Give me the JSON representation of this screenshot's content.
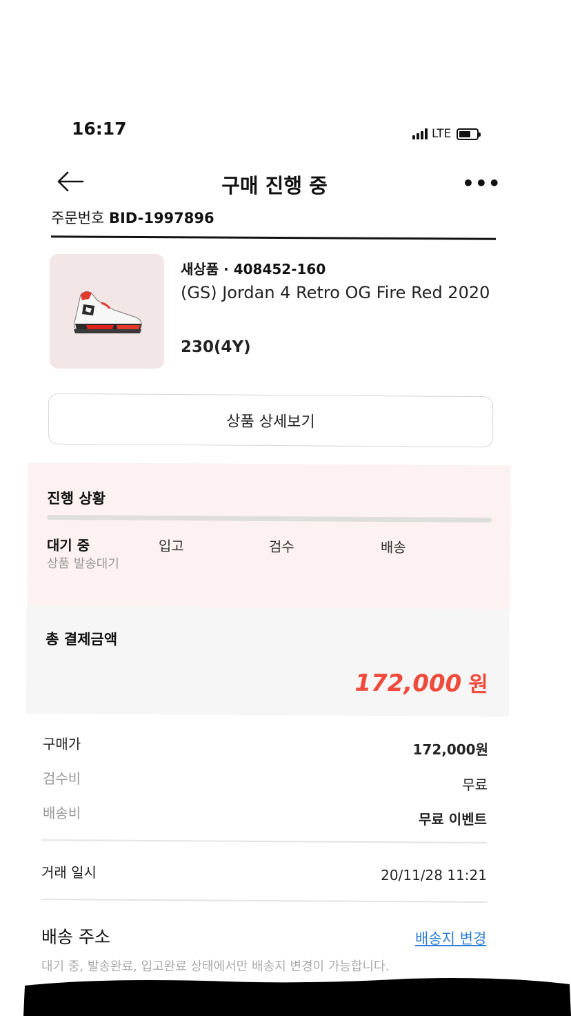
{
  "status_bar": {
    "time": "16:17",
    "network": "LTE"
  },
  "header": {
    "title": "구매 진행 중",
    "more_label": "•••"
  },
  "order": {
    "label": "주문번호",
    "number": "BID-1997896"
  },
  "product": {
    "meta": "새상품 · 408452-160",
    "name": "(GS) Jordan 4 Retro OG Fire Red 2020",
    "size": "230(4Y)",
    "detail_button": "상품 상세보기"
  },
  "progress": {
    "title": "진행 상황",
    "steps": [
      "대기 중",
      "입고",
      "검수",
      "배송"
    ],
    "current_sub": "상품 발송대기"
  },
  "total": {
    "label": "총 결제금액",
    "amount": "172,000",
    "unit": "원"
  },
  "breakdown": [
    {
      "label": "구매가",
      "value": "172,000원"
    },
    {
      "label": "검수비",
      "value": "무료"
    },
    {
      "label": "배송비",
      "value": "무료 이벤트"
    }
  ],
  "transaction": {
    "label": "거래 일시",
    "value": "20/11/28 11:21"
  },
  "address": {
    "title": "배송 주소",
    "change_link": "배송지 변경",
    "note": "대기 중, 발송완료, 입고완료 상태에서만 배송지 변경이 가능합니다."
  },
  "colors": {
    "accent_red": "#ef4a3c",
    "link_blue": "#2b7fd6",
    "progress_bg": "#fdf2f2"
  }
}
